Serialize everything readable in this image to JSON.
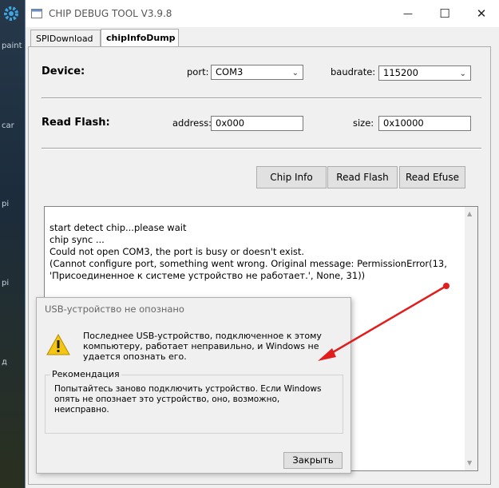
{
  "desktop": {
    "labels": [
      "paint",
      "car",
      "pi",
      "pi",
      "д"
    ]
  },
  "window": {
    "title": "CHIP DEBUG TOOL V3.9.8",
    "controls": [
      "—",
      "☐",
      "✕"
    ]
  },
  "tabs": [
    {
      "label": "SPIDownload"
    },
    {
      "label": "chipInfoDump"
    }
  ],
  "device": {
    "label": "Device:",
    "port_label": "port:",
    "port_value": "COM3",
    "baud_label": "baudrate:",
    "baud_value": "115200"
  },
  "flash": {
    "label": "Read Flash:",
    "address_label": "address:",
    "address_value": "0x000",
    "size_label": "size:",
    "size_value": "0x10000"
  },
  "buttons": {
    "chip_info": "Chip Info",
    "read_flash": "Read Flash",
    "read_efuse": "Read Efuse"
  },
  "log": [
    "start detect chip...please wait",
    "chip sync ...",
    "Could not open COM3, the port is busy or doesn't exist.",
    "(Cannot configure port, something went wrong. Original message: PermissionError(13,",
    "'Присоединенное к системе устройство не работает.', None, 31))"
  ],
  "dialog": {
    "title": "USB-устройство не опознано",
    "message": "Последнее USB-устройство, подключенное к этому компьютеру, работает неправильно, и Windows не удается опознать его.",
    "group_caption": "Рекомендация",
    "recommendation": "Попытайтесь заново подключить устройство. Если Windows опять не опознает это устройство, оно, возможно, неисправно.",
    "close_label": "Закрыть"
  },
  "annotation": {
    "color": "#e01e1e"
  }
}
